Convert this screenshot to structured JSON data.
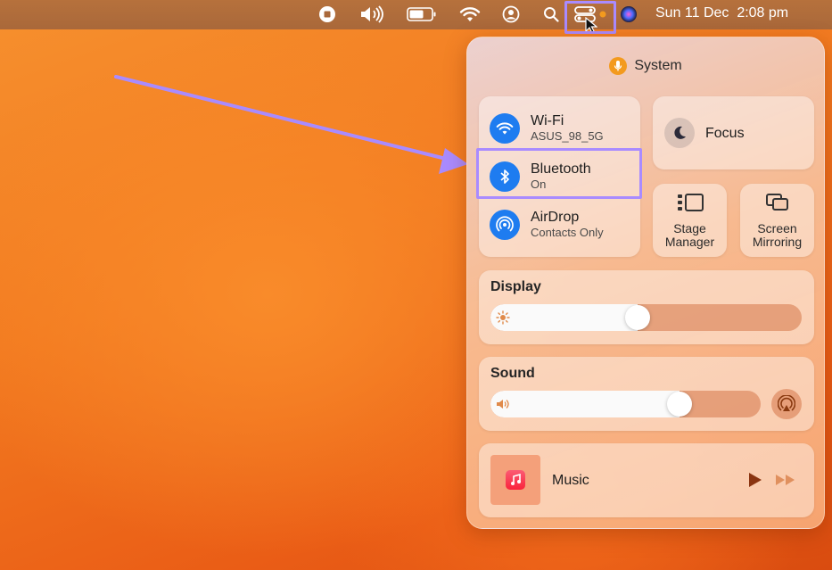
{
  "menubar": {
    "date": "Sun 11 Dec",
    "time": "2:08 pm",
    "icons": [
      "screen-record-icon",
      "volume-icon",
      "battery-icon",
      "wifi-icon",
      "user-icon",
      "search-icon",
      "control-center-icon",
      "siri-icon"
    ]
  },
  "panel": {
    "header": "System",
    "network": {
      "wifi": {
        "title": "Wi-Fi",
        "subtitle": "ASUS_98_5G"
      },
      "bluetooth": {
        "title": "Bluetooth",
        "subtitle": "On"
      },
      "airdrop": {
        "title": "AirDrop",
        "subtitle": "Contacts Only"
      }
    },
    "focus": {
      "label": "Focus"
    },
    "stage_manager": {
      "label_line1": "Stage",
      "label_line2": "Manager"
    },
    "screen_mirroring": {
      "label_line1": "Screen",
      "label_line2": "Mirroring"
    },
    "display": {
      "title": "Display",
      "level": 0.47
    },
    "sound": {
      "title": "Sound",
      "level": 0.72
    },
    "music": {
      "title": "Music"
    }
  },
  "colors": {
    "accent_blue": "#1e7cf0",
    "highlight_purple": "#a98bff",
    "mic_orange": "#f39a1e"
  }
}
